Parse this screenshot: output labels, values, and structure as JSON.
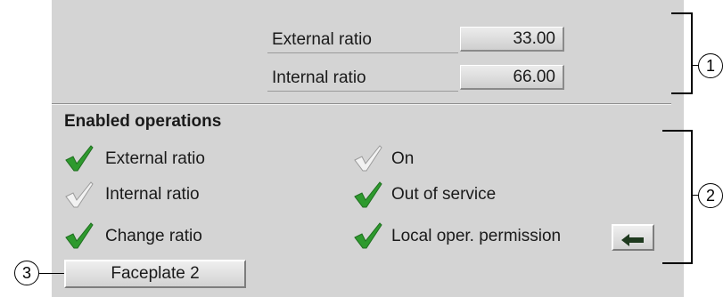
{
  "ratios": [
    {
      "label": "External ratio",
      "value": "33.00"
    },
    {
      "label": "Internal ratio",
      "value": "66.00"
    }
  ],
  "enabled_operations": {
    "title": "Enabled operations",
    "left": [
      {
        "label": "External ratio",
        "enabled": true
      },
      {
        "label": "Internal ratio",
        "enabled": false
      },
      {
        "label": "Change ratio",
        "enabled": true
      }
    ],
    "right": [
      {
        "label": "On",
        "enabled": false
      },
      {
        "label": "Out of service",
        "enabled": true
      },
      {
        "label": "Local oper. permission",
        "enabled": true
      }
    ]
  },
  "faceplate_button": "Faceplate 2",
  "callouts": [
    "1",
    "2",
    "3"
  ],
  "colors": {
    "check_enabled": "#2e9a2e",
    "check_disabled": "#f2f2f2"
  }
}
